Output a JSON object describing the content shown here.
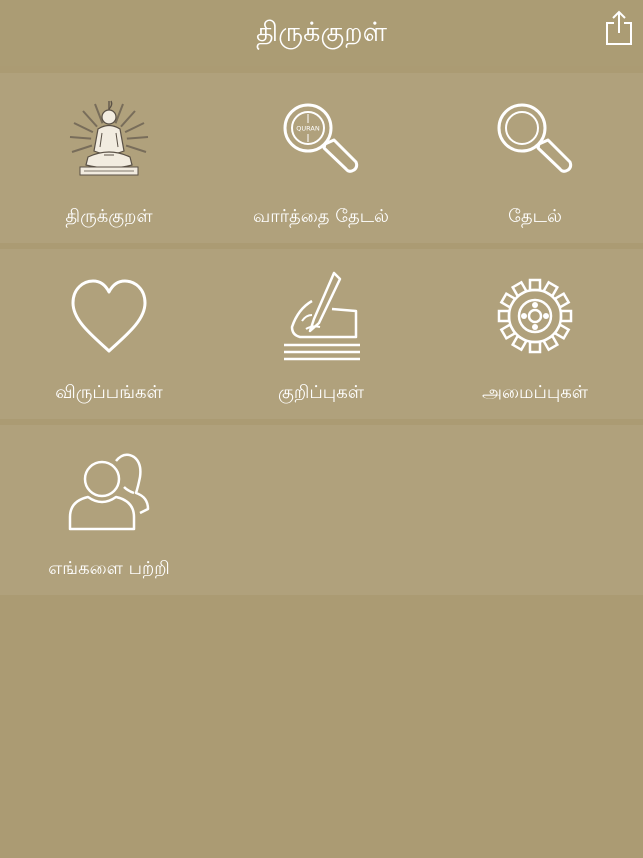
{
  "header": {
    "title": "திருக்குறள்",
    "share_icon": "share-icon"
  },
  "menu": {
    "items": [
      {
        "label": "திருக்குறள்",
        "icon": "thiruvalluvar-icon"
      },
      {
        "label": "வார்த்தை தேடல்",
        "icon": "word-search-icon"
      },
      {
        "label": "தேடல்",
        "icon": "search-icon"
      },
      {
        "label": "விருப்பங்கள்",
        "icon": "heart-icon"
      },
      {
        "label": "குறிப்புகள்",
        "icon": "writing-hand-icon"
      },
      {
        "label": "அமைப்புகள்",
        "icon": "gear-icon"
      },
      {
        "label": "எங்களை பற்றி",
        "icon": "users-icon"
      }
    ],
    "word_search_icon_text": "QURAN"
  },
  "colors": {
    "background": "#ab9b73",
    "tile_row": "#b0a17c",
    "text": "#ffffff"
  }
}
